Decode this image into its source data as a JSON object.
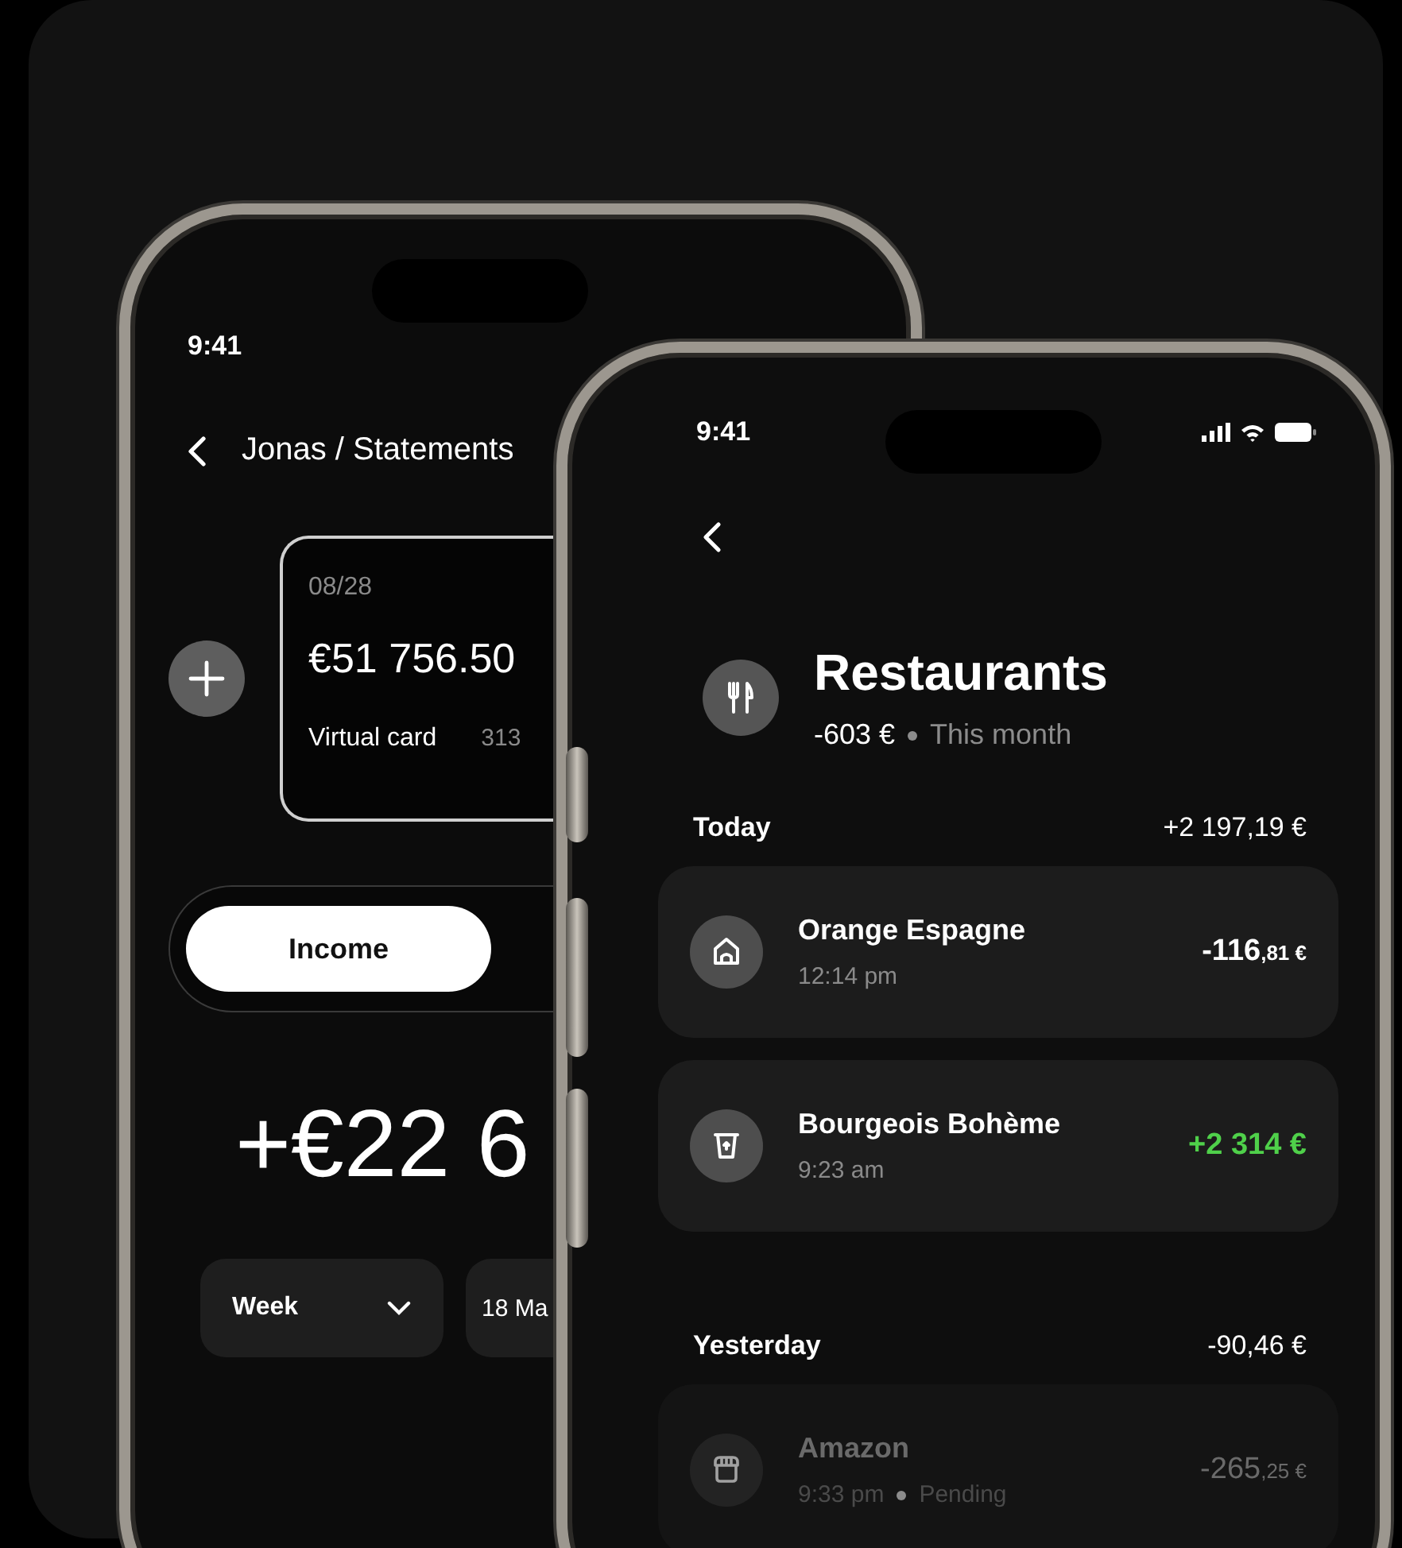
{
  "back_phone": {
    "status_bar": {
      "time": "9:41"
    },
    "nav": {
      "title": "Jonas / Statements"
    },
    "card": {
      "expiry": "08/28",
      "balance": "€51 756.50",
      "label": "Virtual card",
      "number": "313"
    },
    "tabs": [
      {
        "label": "Income",
        "selected": true
      }
    ],
    "total": "+€22 6",
    "filters": [
      {
        "label": "Week",
        "kind": "dropdown"
      },
      {
        "label": "18 Ma",
        "kind": "date"
      }
    ]
  },
  "front_phone": {
    "status_bar": {
      "time": "9:41"
    },
    "category": {
      "title": "Restaurants",
      "amount": "-603 €",
      "period": "This month"
    },
    "groups": [
      {
        "label": "Today",
        "total": "+2 197,19 €",
        "transactions": [
          {
            "name": "Orange Espagne",
            "time": "12:14 pm",
            "amount": "-116",
            "cents": ",81 €",
            "kind": "house",
            "color": "#ffffff",
            "pending": false
          },
          {
            "name": "Bourgeois Bohème",
            "time": "9:23 am",
            "amount": "+2 314 €",
            "kind": "cup",
            "color": "#4fd04a",
            "pending": false
          }
        ]
      },
      {
        "label": "Yesterday",
        "total": "-90,46 €",
        "transactions": [
          {
            "name": "Amazon",
            "time": "9:33 pm",
            "status": "Pending",
            "amount": "-265",
            "cents": ",25 €",
            "kind": "store",
            "color": "#6a6a6a",
            "pending": true
          }
        ]
      }
    ]
  }
}
